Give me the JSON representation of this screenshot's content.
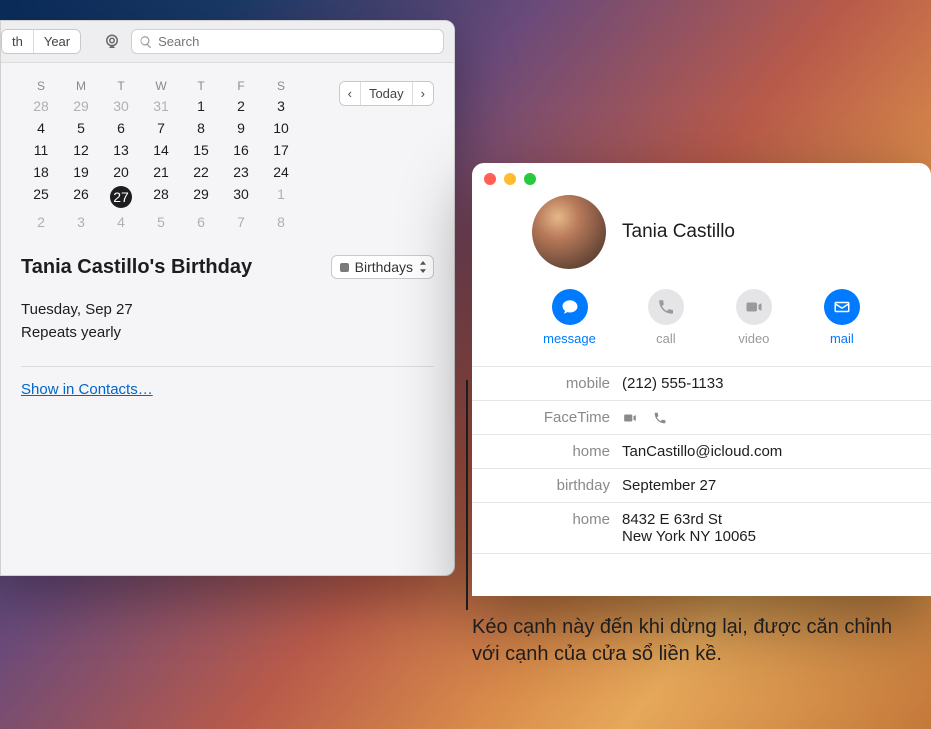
{
  "calendar": {
    "toolbar": {
      "view_month_partial": "th",
      "view_year": "Year",
      "search_placeholder": "Search"
    },
    "nav": {
      "prev": "‹",
      "today": "Today",
      "next": "›"
    },
    "dow": [
      "S",
      "M",
      "T",
      "W",
      "T",
      "F",
      "S"
    ],
    "weeks": [
      [
        {
          "d": "28",
          "dim": true
        },
        {
          "d": "29",
          "dim": true
        },
        {
          "d": "30",
          "dim": true
        },
        {
          "d": "31",
          "dim": true
        },
        {
          "d": "1"
        },
        {
          "d": "2"
        },
        {
          "d": "3"
        }
      ],
      [
        {
          "d": "4"
        },
        {
          "d": "5"
        },
        {
          "d": "6"
        },
        {
          "d": "7"
        },
        {
          "d": "8"
        },
        {
          "d": "9"
        },
        {
          "d": "10"
        }
      ],
      [
        {
          "d": "11"
        },
        {
          "d": "12"
        },
        {
          "d": "13"
        },
        {
          "d": "14"
        },
        {
          "d": "15"
        },
        {
          "d": "16"
        },
        {
          "d": "17"
        }
      ],
      [
        {
          "d": "18"
        },
        {
          "d": "19"
        },
        {
          "d": "20"
        },
        {
          "d": "21"
        },
        {
          "d": "22"
        },
        {
          "d": "23"
        },
        {
          "d": "24"
        }
      ],
      [
        {
          "d": "25"
        },
        {
          "d": "26"
        },
        {
          "d": "27",
          "sel": true
        },
        {
          "d": "28"
        },
        {
          "d": "29"
        },
        {
          "d": "30"
        },
        {
          "d": "1",
          "dim": true
        }
      ],
      [
        {
          "d": "2",
          "dim": true
        },
        {
          "d": "3",
          "dim": true
        },
        {
          "d": "4",
          "dim": true
        },
        {
          "d": "5",
          "dim": true
        },
        {
          "d": "6",
          "dim": true
        },
        {
          "d": "7",
          "dim": true
        },
        {
          "d": "8",
          "dim": true
        }
      ]
    ],
    "event": {
      "title": "Tania Castillo's Birthday",
      "calendar_name": "Birthdays",
      "date": "Tuesday, Sep 27",
      "repeat": "Repeats yearly",
      "show_in_contacts": "Show in Contacts…"
    }
  },
  "contacts": {
    "name": "Tania Castillo",
    "actions": {
      "message": "message",
      "call": "call",
      "video": "video",
      "mail": "mail"
    },
    "fields": {
      "mobile_label": "mobile",
      "mobile_value": "(212) 555-1133",
      "facetime_label": "FaceTime",
      "home_email_label": "home",
      "home_email_value": "TanCastillo@icloud.com",
      "birthday_label": "birthday",
      "birthday_value": "September 27",
      "home_addr_label": "home",
      "home_addr_line1": "8432 E 63rd St",
      "home_addr_line2": "New York NY 10065"
    }
  },
  "annotation": "Kéo cạnh này đến khi dừng lại, được căn chỉnh với cạnh của cửa sổ liền kề."
}
